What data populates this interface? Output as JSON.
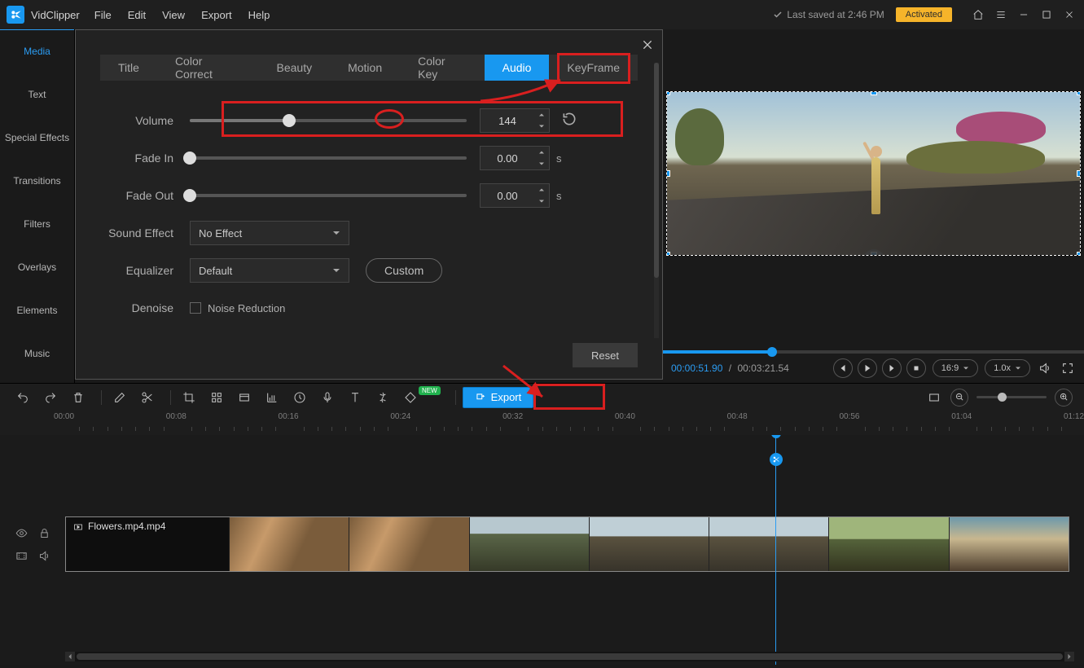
{
  "titlebar": {
    "app_name": "VidClipper",
    "menus": [
      "File",
      "Edit",
      "View",
      "Export",
      "Help"
    ],
    "save_info": "Last saved at 2:46 PM",
    "activated": "Activated"
  },
  "sidebar": {
    "items": [
      "Media",
      "Text",
      "Special Effects",
      "Transitions",
      "Filters",
      "Overlays",
      "Elements",
      "Music"
    ],
    "active_index": 0
  },
  "panel": {
    "tabs": [
      "Title",
      "Color Correct",
      "Beauty",
      "Motion",
      "Color Key",
      "Audio",
      "KeyFrame"
    ],
    "active_index": 5,
    "volume": {
      "label": "Volume",
      "value": "144",
      "percent": 36
    },
    "fade_in": {
      "label": "Fade In",
      "value": "0.00",
      "unit": "s",
      "percent": 0
    },
    "fade_out": {
      "label": "Fade Out",
      "value": "0.00",
      "unit": "s",
      "percent": 0
    },
    "sound_effect": {
      "label": "Sound Effect",
      "value": "No Effect"
    },
    "equalizer": {
      "label": "Equalizer",
      "value": "Default",
      "custom_btn": "Custom"
    },
    "denoise": {
      "label": "Denoise",
      "checkbox": "Noise Reduction"
    },
    "reset_btn": "Reset"
  },
  "preview": {
    "current_time": "00:00:51.90",
    "total_time": "00:03:21.54",
    "aspect": "16:9",
    "speed": "1.0x"
  },
  "toolbar": {
    "export": "Export",
    "new_badge": "NEW"
  },
  "ruler": {
    "ticks": [
      "00:00",
      "00:08",
      "00:16",
      "00:24",
      "00:32",
      "00:40",
      "00:48",
      "00:56",
      "01:04",
      "01:12"
    ]
  },
  "clip": {
    "name": "Flowers.mp4.mp4"
  }
}
